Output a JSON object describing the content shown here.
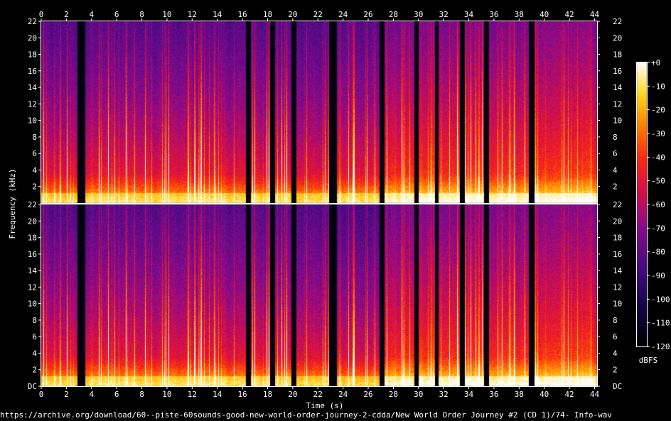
{
  "chart_data": {
    "type": "heatmap",
    "xlabel": "Time (s)",
    "ylabel": "Frequency (kHz)",
    "x_ticks": [
      0,
      2,
      4,
      6,
      8,
      10,
      12,
      14,
      16,
      18,
      20,
      22,
      24,
      26,
      28,
      30,
      32,
      34,
      36,
      38,
      40,
      42,
      44
    ],
    "x_tick_labels": [
      "0",
      "2",
      "4",
      "6",
      "8",
      "10",
      "12",
      "14",
      "16",
      "18",
      "20",
      "22",
      "24",
      "26",
      "28",
      "30",
      "32",
      "34",
      "36",
      "38",
      "40",
      "42",
      "44"
    ],
    "xlim": [
      0,
      44.2
    ],
    "channels": [
      {
        "y_ticks": [
          2,
          4,
          6,
          8,
          10,
          12,
          14,
          16,
          18,
          20,
          22
        ],
        "y_tick_labels": [
          "2",
          "4",
          "6",
          "8",
          "10",
          "12",
          "14",
          "16",
          "18",
          "20",
          "22"
        ]
      },
      {
        "y_ticks": [
          0,
          2,
          4,
          6,
          8,
          10,
          12,
          14,
          16,
          18,
          20,
          22
        ],
        "y_tick_labels": [
          "DC",
          "2",
          "4",
          "6",
          "8",
          "10",
          "12",
          "14",
          "16",
          "18",
          "20",
          "22"
        ]
      }
    ],
    "ylim": [
      0,
      22
    ],
    "silent_gaps_s": [
      [
        2.9,
        3.5
      ],
      [
        16.3,
        16.7
      ],
      [
        18.2,
        18.6
      ],
      [
        19.9,
        20.3
      ],
      [
        22.9,
        23.5
      ],
      [
        26.9,
        27.3
      ],
      [
        29.7,
        30.0
      ],
      [
        31.3,
        31.6
      ],
      [
        33.3,
        33.7
      ],
      [
        35.2,
        35.6
      ],
      [
        38.8,
        39.2
      ]
    ],
    "colorbar": {
      "ticks": [
        0,
        -10,
        -20,
        -30,
        -40,
        -50,
        -60,
        -70,
        -80,
        -90,
        -100,
        -110,
        -120
      ],
      "tick_labels": [
        "+0",
        "-10",
        "-20",
        "-30",
        "-40",
        "-50",
        "-60",
        "-70",
        "-80",
        "-90",
        "-100",
        "-110",
        "-120"
      ],
      "label": "dBFS",
      "range": [
        -120,
        0
      ]
    }
  },
  "source_url": "https://archive.org/download/60--piste-60sounds-good-new-world-order-journey-2-cdda/New World Order Journey #2 (CD 1)/74- Info-wav"
}
